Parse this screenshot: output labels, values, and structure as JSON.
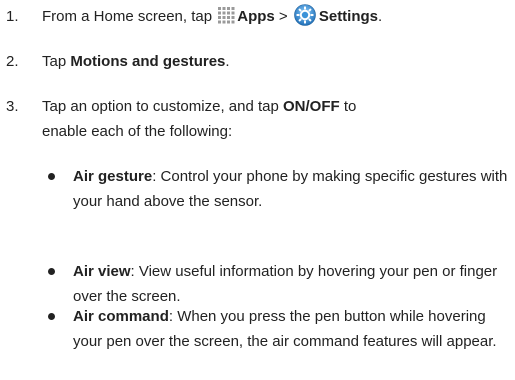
{
  "steps": [
    {
      "number": "1.",
      "pre": "From a Home screen, tap",
      "apps_label": "Apps",
      "separator": ">",
      "settings_label": "Settings",
      "post": ".",
      "icons": [
        "apps-grid-icon",
        "settings-gear-icon"
      ]
    },
    {
      "number": "2.",
      "pre": "Tap",
      "bold": "Motions and gestures",
      "post": "."
    },
    {
      "number": "3.",
      "line1_pre": "Tap an option to customize, and tap",
      "line1_bold": "ON/OFF",
      "line1_post": "to",
      "line2": "enable each of the following:"
    }
  ],
  "bullets": [
    {
      "bold": "Air gesture",
      "text": ": Control your phone by making specific gestures with your hand above the sensor."
    },
    {
      "bold": "Air view",
      "text": ": View useful information by hovering your pen or finger over the screen."
    },
    {
      "bold": "Air command",
      "text": ": When you press the pen button while hovering your pen over the screen, the air command features will appear."
    }
  ],
  "colors": {
    "text": "#222222",
    "settings_icon_blue": "#2f8fd8",
    "apps_icon_gray": "#9a9a9a"
  }
}
